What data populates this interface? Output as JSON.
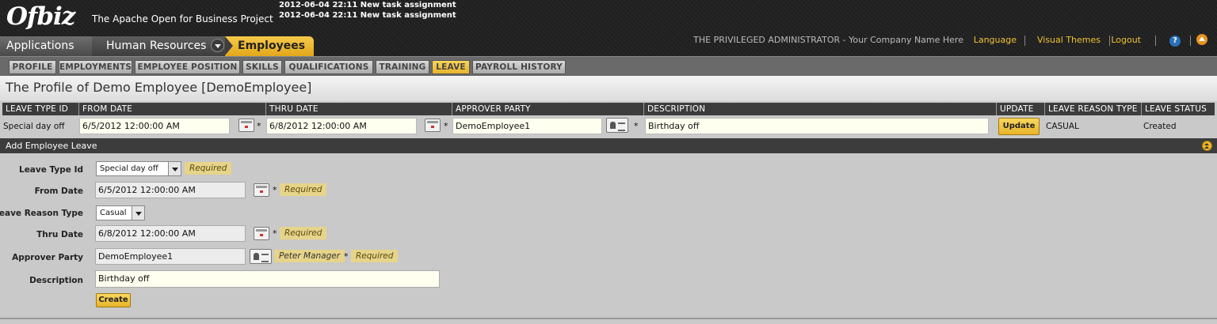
{
  "header": {
    "logo": "Ofbiz",
    "tagline": "The Apache Open for Business Project",
    "notices": [
      "2012-06-04 22:11 New task assignment",
      "2012-06-04 22:11 New task assignment"
    ],
    "apps": [
      "Applications",
      "Human Resources",
      "Employees"
    ],
    "user": "THE PRIVILEGED ADMINISTRATOR - Your Company Name Here",
    "links": [
      "Language",
      "Visual Themes",
      "Logout"
    ],
    "help": "?"
  },
  "tabs": [
    "PROFILE",
    "EMPLOYMENTS",
    "EMPLOYEE POSITION",
    "SKILLS",
    "QUALIFICATIONS",
    "TRAINING",
    "LEAVE",
    "PAYROLL HISTORY"
  ],
  "selected_tab": "LEAVE",
  "page_title": "The Profile of Demo Employee [DemoEmployee]",
  "list": {
    "columns": [
      "LEAVE TYPE ID",
      "FROM DATE",
      "THRU DATE",
      "APPROVER PARTY",
      "DESCRIPTION",
      "UPDATE",
      "LEAVE REASON TYPE",
      "LEAVE STATUS"
    ],
    "row": {
      "leave_type": "Special day off",
      "from_date": "6/5/2012 12:00:00 AM",
      "thru_date": "6/8/2012 12:00:00 AM",
      "approver": "DemoEmployee1",
      "description": "Birthday off",
      "update_label": "Update",
      "reason": "CASUAL",
      "status": "Created"
    }
  },
  "form": {
    "title": "Add Employee Leave",
    "labels": {
      "leave_type": "Leave Type Id",
      "from_date": "From Date",
      "reason": "Leave Reason Type",
      "thru_date": "Thru Date",
      "approver": "Approver Party",
      "description": "Description"
    },
    "values": {
      "leave_type": "Special day off",
      "from_date": "6/5/2012 12:00:00 AM",
      "reason": "Casual",
      "thru_date": "6/8/2012 12:00:00 AM",
      "approver": "DemoEmployee1",
      "approver_name": "Peter Manager",
      "description": "Birthday off"
    },
    "required": "Required",
    "star": "*",
    "create_label": "Create"
  }
}
